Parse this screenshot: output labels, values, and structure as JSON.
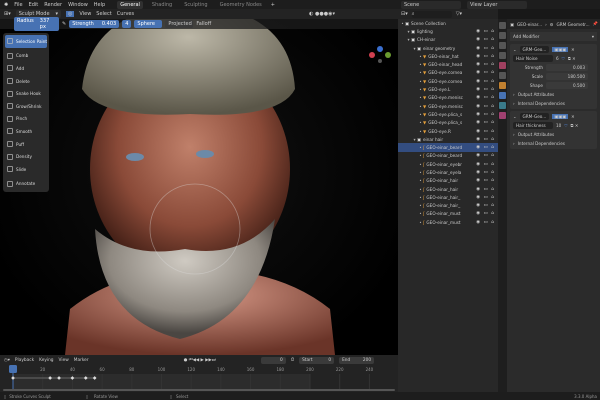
{
  "menu": {
    "items": [
      "File",
      "Edit",
      "Render",
      "Window",
      "Help"
    ],
    "workspaces": [
      "General",
      "Shading",
      "Sculpting",
      "Geometry Nodes"
    ],
    "active_workspace": "General",
    "scene": "Scene",
    "view_layer": "View Layer"
  },
  "header": {
    "mode": "Sculpt Mode",
    "menus": [
      "View",
      "Select",
      "Curves"
    ]
  },
  "tool_settings": {
    "radius_label": "Radius",
    "radius_value": "337 px",
    "strength_label": "Strength",
    "strength_value": "0.403",
    "count": "4",
    "sphere": "Sphere",
    "projected": "Projected",
    "falloff": "Falloff"
  },
  "tools": [
    "Selection Paint",
    "Comb",
    "Add",
    "Delete",
    "Snake Hook",
    "Grow/Shrink",
    "Pinch",
    "Smooth",
    "Puff",
    "Density",
    "Slide",
    "Annotate"
  ],
  "active_tool": "Selection Paint",
  "outliner": {
    "rows": [
      {
        "label": "Scene Collection",
        "depth": 0,
        "type": "collection"
      },
      {
        "label": "lighting",
        "depth": 1,
        "type": "collection"
      },
      {
        "label": "CH-einar",
        "depth": 1,
        "type": "collection"
      },
      {
        "label": "einar geometry",
        "depth": 2,
        "type": "collection"
      },
      {
        "label": "GEO-einar_hat",
        "depth": 3,
        "type": "mesh"
      },
      {
        "label": "GEO-einar_head",
        "depth": 3,
        "type": "mesh"
      },
      {
        "label": "GEO-eye.cornea",
        "depth": 3,
        "type": "mesh"
      },
      {
        "label": "GEO-eye.cornea",
        "depth": 3,
        "type": "mesh"
      },
      {
        "label": "GEO-eye.L",
        "depth": 3,
        "type": "mesh"
      },
      {
        "label": "GEO-eye.menisc",
        "depth": 3,
        "type": "mesh"
      },
      {
        "label": "GEO-eye.menisc",
        "depth": 3,
        "type": "mesh"
      },
      {
        "label": "GEO-eye.plica_s",
        "depth": 3,
        "type": "mesh"
      },
      {
        "label": "GEO-eye.plica_s",
        "depth": 3,
        "type": "mesh"
      },
      {
        "label": "GEO-eye.R",
        "depth": 3,
        "type": "mesh"
      },
      {
        "label": "einar hair",
        "depth": 2,
        "type": "collection"
      },
      {
        "label": "GEO-einar_beard",
        "depth": 3,
        "type": "curves",
        "selected": true
      },
      {
        "label": "GEO-einar_beard",
        "depth": 3,
        "type": "curves"
      },
      {
        "label": "GEO-einar_eyebr",
        "depth": 3,
        "type": "curves"
      },
      {
        "label": "GEO-einar_eyela",
        "depth": 3,
        "type": "curves"
      },
      {
        "label": "GEO-einar_hair",
        "depth": 3,
        "type": "curves"
      },
      {
        "label": "GEO-einar_hair",
        "depth": 3,
        "type": "curves"
      },
      {
        "label": "GEO-einar_hair_",
        "depth": 3,
        "type": "curves"
      },
      {
        "label": "GEO-einar_hair_",
        "depth": 3,
        "type": "curves"
      },
      {
        "label": "GEO-einar_must",
        "depth": 3,
        "type": "curves"
      },
      {
        "label": "GEO-einar_must",
        "depth": 3,
        "type": "curves"
      }
    ]
  },
  "properties": {
    "breadcrumb_object": "GEO-einar...",
    "breadcrumb_modifier": "GRM Geometr...",
    "add_modifier": "Add Modifier",
    "modifier1": {
      "name": "GRM-Geo...",
      "node_group": "Hair Noise",
      "users": "6",
      "fields": [
        {
          "label": "Strength",
          "value": "0.003"
        },
        {
          "label": "Scale",
          "value": "180.500"
        },
        {
          "label": "Shape",
          "value": "0.500"
        }
      ],
      "output_attributes": "Output Attributes",
      "internal_dependencies": "Internal Dependencies"
    },
    "modifier2": {
      "name": "GRM-Geo...",
      "node_group": "Hair thickness",
      "users": "10",
      "output_attributes": "Output Attributes",
      "internal_dependencies": "Internal Dependencies"
    }
  },
  "timeline": {
    "menus": [
      "Playback",
      "Keying",
      "View",
      "Marker"
    ],
    "current_frame": "0",
    "start_label": "Start",
    "start": "0",
    "end_label": "End",
    "end": "200",
    "ticks": [
      "0",
      "20",
      "40",
      "60",
      "80",
      "100",
      "120",
      "140",
      "160",
      "180",
      "200",
      "220",
      "240"
    ],
    "keyframes": [
      0,
      25,
      31,
      40,
      49,
      55
    ]
  },
  "status": {
    "left": "Stroke Curves Sculpt",
    "middle": "Rotate View",
    "right": "Select",
    "version": "3.3.0 Alpha"
  },
  "colors": {
    "accent": "#4772b3",
    "selected_row": "#334d80",
    "mesh_icon": "#e8a13a"
  }
}
